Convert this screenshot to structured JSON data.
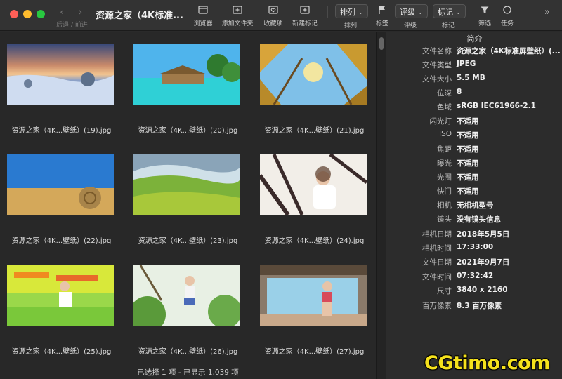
{
  "window": {
    "title": "资源之家（4K标准..."
  },
  "nav": {
    "back": "‹",
    "forward": "›",
    "label": "后退 / 前进"
  },
  "toolbar": {
    "browser": "浏览器",
    "add_folder": "添加文件夹",
    "favorites": "收藏项",
    "new_tag": "新建标记",
    "sort_value": "排列",
    "sort_label": "排列",
    "tag_label": "标签",
    "rating_value": "评级",
    "rating_label": "评级",
    "mark_value": "标记",
    "mark_label": "标记",
    "filter_label": "筛选",
    "tasks_label": "任务",
    "more": "»"
  },
  "grid": {
    "items": [
      {
        "name": "资源之家（4K...壁纸）(19).jpg",
        "scene": "snow-sunset"
      },
      {
        "name": "资源之家（4K...壁纸）(20).jpg",
        "scene": "tropical-beach"
      },
      {
        "name": "资源之家（4K...壁纸）(21).jpg",
        "scene": "forest-sky"
      },
      {
        "name": "资源之家（4K...壁纸）(22).jpg",
        "scene": "hay-field"
      },
      {
        "name": "资源之家（4K...壁纸）(23).jpg",
        "scene": "green-hills"
      },
      {
        "name": "资源之家（4K...壁纸）(24).jpg",
        "scene": "portrait-window"
      },
      {
        "name": "资源之家（4K...壁纸）(25).jpg",
        "scene": "portrait-fruit-stand"
      },
      {
        "name": "资源之家（4K...壁纸）(26).jpg",
        "scene": "portrait-garden"
      },
      {
        "name": "资源之家（4K...壁纸）(27).jpg",
        "scene": "portrait-porch"
      }
    ],
    "status": "已选择  1 项 - 已显示 1,039 项"
  },
  "info": {
    "header": "简介",
    "rows": [
      {
        "key": "文件名称",
        "value": "资源之家（4K标准屏壁纸）(..."
      },
      {
        "key": "文件类型",
        "value": "JPEG"
      },
      {
        "key": "文件大小",
        "value": "5.5 MB"
      },
      {
        "key": "位深",
        "value": "8"
      },
      {
        "key": "色域",
        "value": "sRGB IEC61966-2.1"
      },
      {
        "key": "闪光灯",
        "value": "不适用"
      },
      {
        "key": "ISO",
        "value": "不适用"
      },
      {
        "key": "焦距",
        "value": "不适用"
      },
      {
        "key": "曝光",
        "value": "不适用"
      },
      {
        "key": "光圈",
        "value": "不适用"
      },
      {
        "key": "快门",
        "value": "不适用"
      },
      {
        "key": "相机",
        "value": "无相机型号"
      },
      {
        "key": "镜头",
        "value": "没有镜头信息"
      },
      {
        "key": "相机日期",
        "value": "2018年5月5日"
      },
      {
        "key": "相机时间",
        "value": "17:33:00"
      },
      {
        "key": "文件日期",
        "value": "2021年9月7日"
      },
      {
        "key": "文件时间",
        "value": "07:32:42"
      },
      {
        "key": "尺寸",
        "value": "3840 x 2160"
      },
      {
        "key": "百万像素",
        "value": "8.3 百万像素"
      }
    ]
  },
  "watermark": "CGtimo.com",
  "colors": {
    "background": "#2a2a2a",
    "toolbar": "#333333",
    "watermark": "#f5e11c"
  }
}
